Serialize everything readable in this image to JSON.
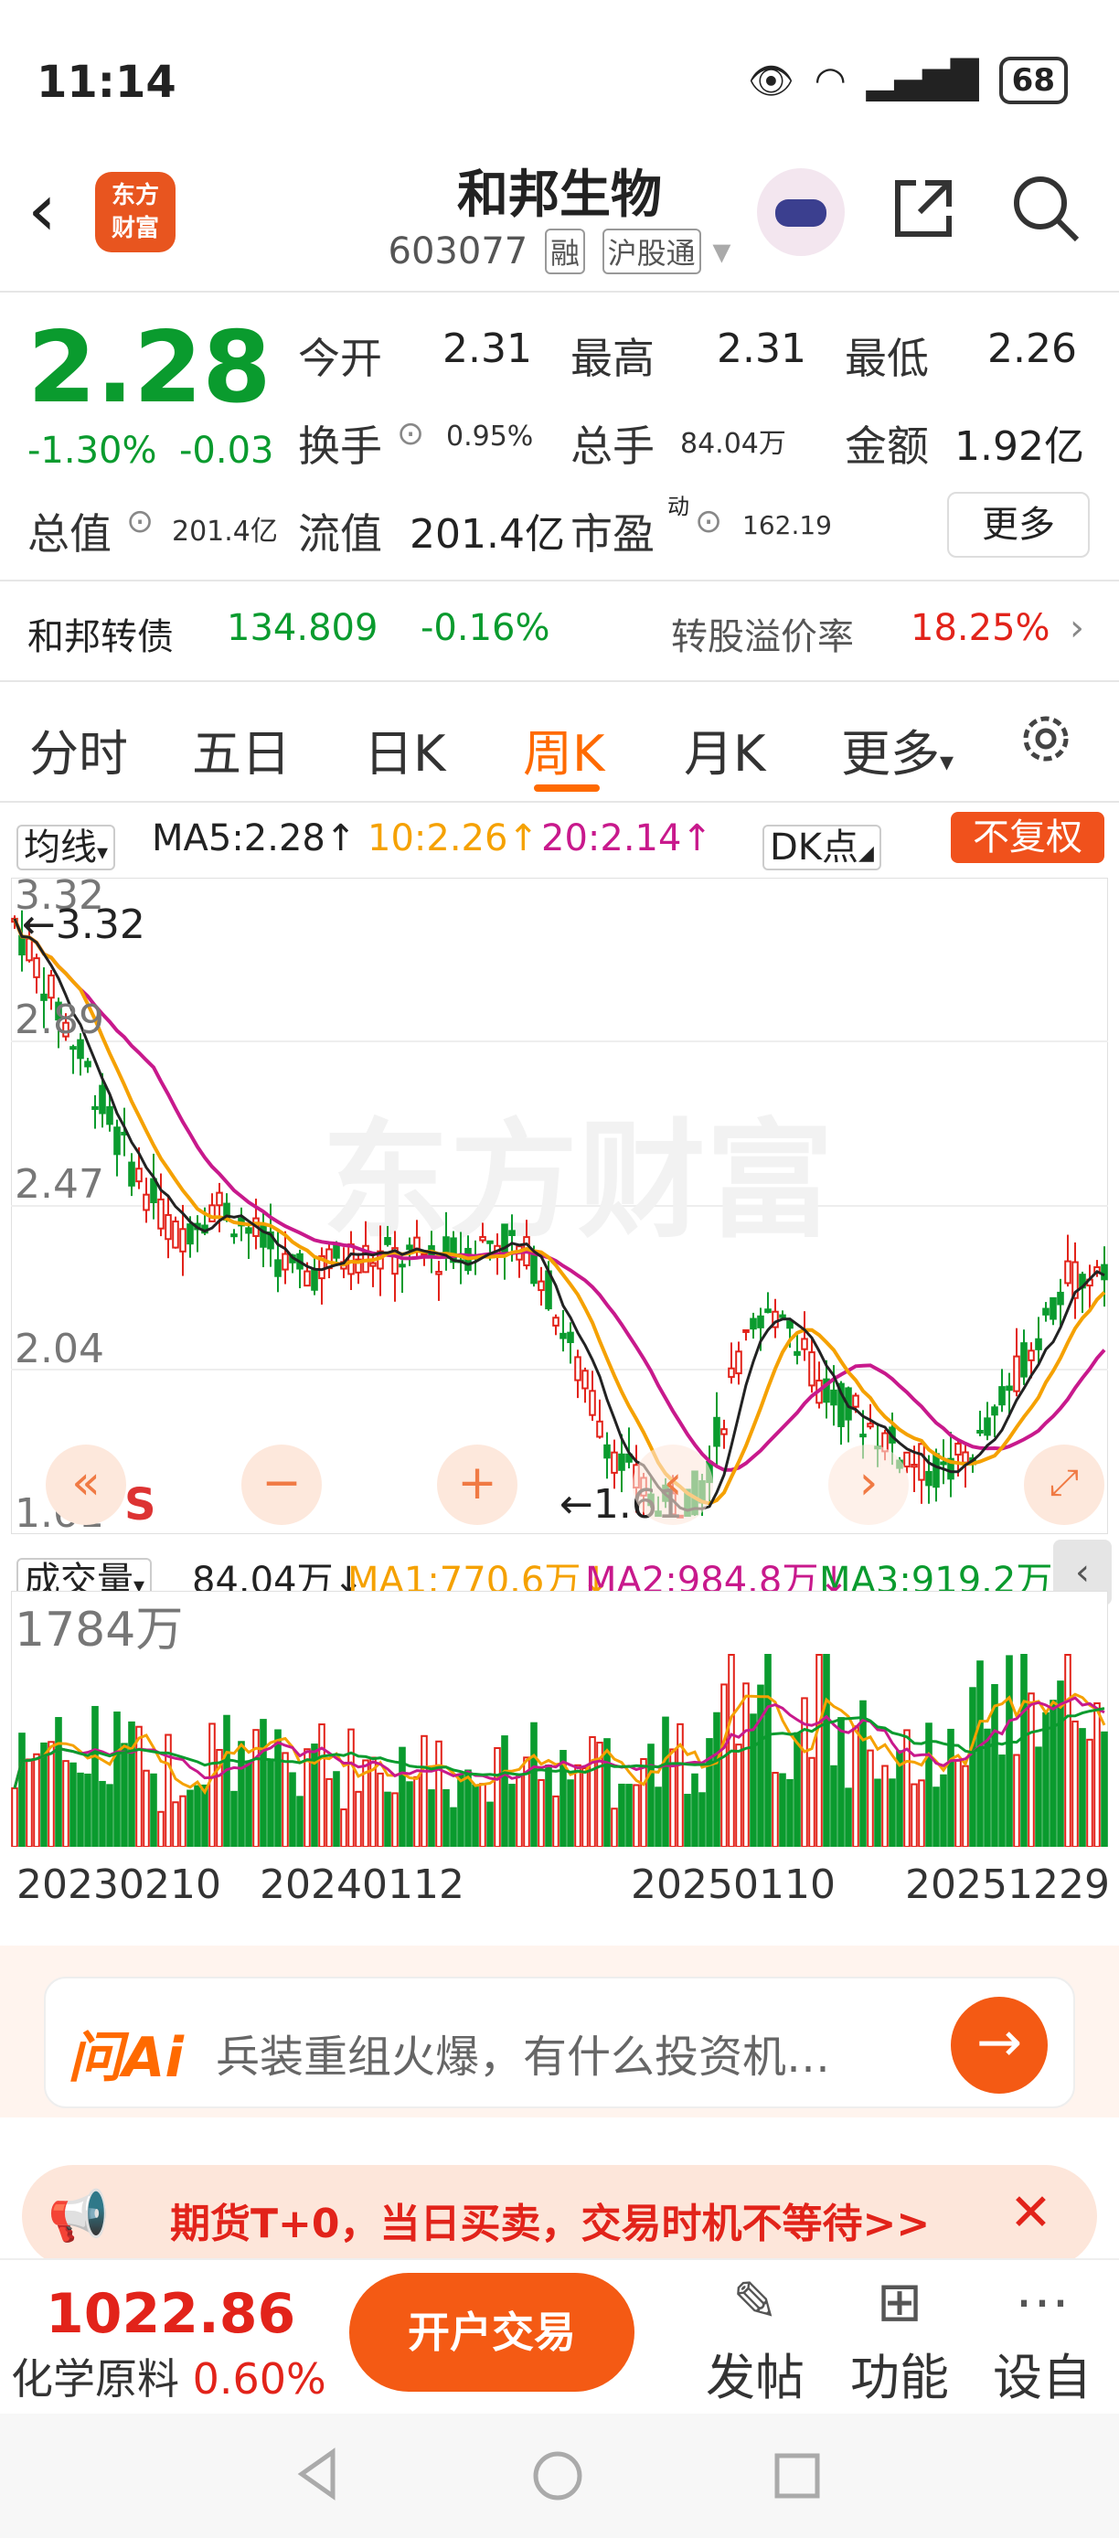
{
  "status": {
    "time": "11:14",
    "battery": "68"
  },
  "header": {
    "back": "‹",
    "logo": "东方\n财富",
    "name": "和邦生物",
    "code": "603077",
    "tag_margin": "融",
    "tag_connect": "沪股通"
  },
  "quote": {
    "price": "2.28",
    "change_pct": "-1.30%",
    "change": "-0.03",
    "open_label": "今开",
    "open": "2.31",
    "high_label": "最高",
    "high": "2.31",
    "low_label": "最低",
    "low": "2.26",
    "turnover_label": "换手",
    "turnover": "0.95%",
    "volume_label": "总手",
    "volume": "84.04万",
    "amount_label": "金额",
    "amount": "1.92亿",
    "mktcap_label": "总值",
    "mktcap": "201.4亿",
    "float_label": "流值",
    "float_cap": "201.4亿",
    "pe_label": "市盈",
    "pe_sup": "动",
    "pe": "162.19",
    "more": "更多"
  },
  "bond": {
    "name": "和邦转债",
    "price": "134.809",
    "change": "-0.16%",
    "premium_label": "转股溢价率",
    "premium": "18.25%"
  },
  "tabs": [
    "分时",
    "五日",
    "日K",
    "周K",
    "月K",
    "更多"
  ],
  "active_tab": "周K",
  "indicator": {
    "selector": "均线",
    "ma5": "MA5:2.28↑",
    "ma10": "10:2.26↑",
    "ma20": "20:2.14↑",
    "dk": "DK点",
    "adjust": "不复权"
  },
  "chart": {
    "y_labels": [
      "3.32",
      "2.89",
      "2.47",
      "2.04",
      "1.61"
    ],
    "max_marker": "←3.32",
    "min_marker": "←1.61",
    "watermark": "东方财富",
    "s_mark": "S",
    "colors": {
      "up": "#e2231a",
      "down": "#0a9b2e",
      "ma5": "#222222",
      "ma10": "#f5a100",
      "ma20": "#c8198c"
    }
  },
  "volume": {
    "selector": "成交量",
    "value": "84.04万↓",
    "ma1": "MA1:770.6万↓",
    "ma2": "MA2:984.8万↓",
    "ma3": "MA3:919.2万↓",
    "max_label": "1784万",
    "x_labels": [
      "20230210",
      "20240112",
      "20250110",
      "20251229"
    ]
  },
  "ai": {
    "logo": "问Ai",
    "placeholder": "兵装重组火爆，有什么投资机…",
    "go": "→"
  },
  "promo": {
    "text": "期货T+0，当日买卖，交易时机不等待>>"
  },
  "bottom": {
    "index_value": "1022.86",
    "index_name": "化学原料",
    "index_change": "0.60%",
    "trade": "开户交易",
    "post": "发帖",
    "functions": "功能",
    "watchlist": "设自"
  }
}
